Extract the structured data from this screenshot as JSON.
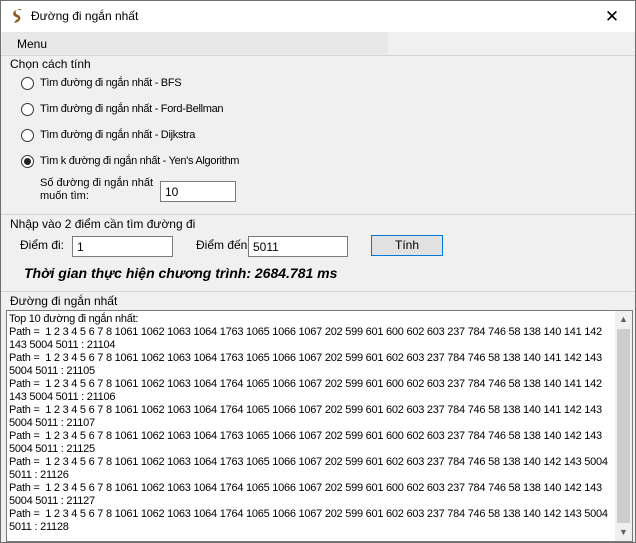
{
  "window": {
    "title": "Đường đi ngắn nhất",
    "close_glyph": "✕"
  },
  "menu": {
    "label": "Menu"
  },
  "algorithm": {
    "group_label": "Chọn cách tính",
    "options": [
      {
        "label": "Tìm đường đi ngắn nhất - BFS",
        "checked": false
      },
      {
        "label": "Tìm đường đi ngắn nhất - Ford-Bellman",
        "checked": false
      },
      {
        "label": "Tìm đường đi ngắn nhất - Dijkstra",
        "checked": false
      },
      {
        "label": "Tìm k đường đi ngắn nhất - Yen's Algorithm",
        "checked": true
      }
    ],
    "k_label": "Số đường đi ngắn nhất muốn tìm:",
    "k_value": "10"
  },
  "points": {
    "group_label": "Nhập vào 2 điểm cần tìm đường đi",
    "start_label": "Điểm đi:",
    "start_value": "1",
    "end_label": "Điểm đến:",
    "end_value": "5011",
    "compute_button": "Tính"
  },
  "runtime": {
    "text": "Thời gian thực hiện chương trình: 2684.781 ms"
  },
  "result": {
    "group_label": "Đường đi ngắn nhất",
    "text": "Top 10 đường đi ngắn nhất:\nPath =  1 2 3 4 5 6 7 8 1061 1062 1063 1064 1763 1065 1066 1067 202 599 601 600 602 603 237 784 746 58 138 140 141 142 143 5004 5011 : 21104\nPath =  1 2 3 4 5 6 7 8 1061 1062 1063 1064 1763 1065 1066 1067 202 599 601 602 603 237 784 746 58 138 140 141 142 143 5004 5011 : 21105\nPath =  1 2 3 4 5 6 7 8 1061 1062 1063 1064 1764 1065 1066 1067 202 599 601 600 602 603 237 784 746 58 138 140 141 142 143 5004 5011 : 21106\nPath =  1 2 3 4 5 6 7 8 1061 1062 1063 1064 1764 1065 1066 1067 202 599 601 602 603 237 784 746 58 138 140 141 142 143 5004 5011 : 21107\nPath =  1 2 3 4 5 6 7 8 1061 1062 1063 1064 1763 1065 1066 1067 202 599 601 600 602 603 237 784 746 58 138 140 142 143 5004 5011 : 21125\nPath =  1 2 3 4 5 6 7 8 1061 1062 1063 1064 1763 1065 1066 1067 202 599 601 602 603 237 784 746 58 138 140 142 143 5004 5011 : 21126\nPath =  1 2 3 4 5 6 7 8 1061 1062 1063 1064 1764 1065 1066 1067 202 599 601 600 602 603 237 784 746 58 138 140 142 143 5004 5011 : 21127\nPath =  1 2 3 4 5 6 7 8 1061 1062 1063 1064 1764 1065 1066 1067 202 599 601 602 603 237 784 746 58 138 140 142 143 5004 5011 : 21128"
  },
  "icons": {
    "app": "app-logo-icon",
    "scroll_up": "▲",
    "scroll_down": "▼"
  }
}
